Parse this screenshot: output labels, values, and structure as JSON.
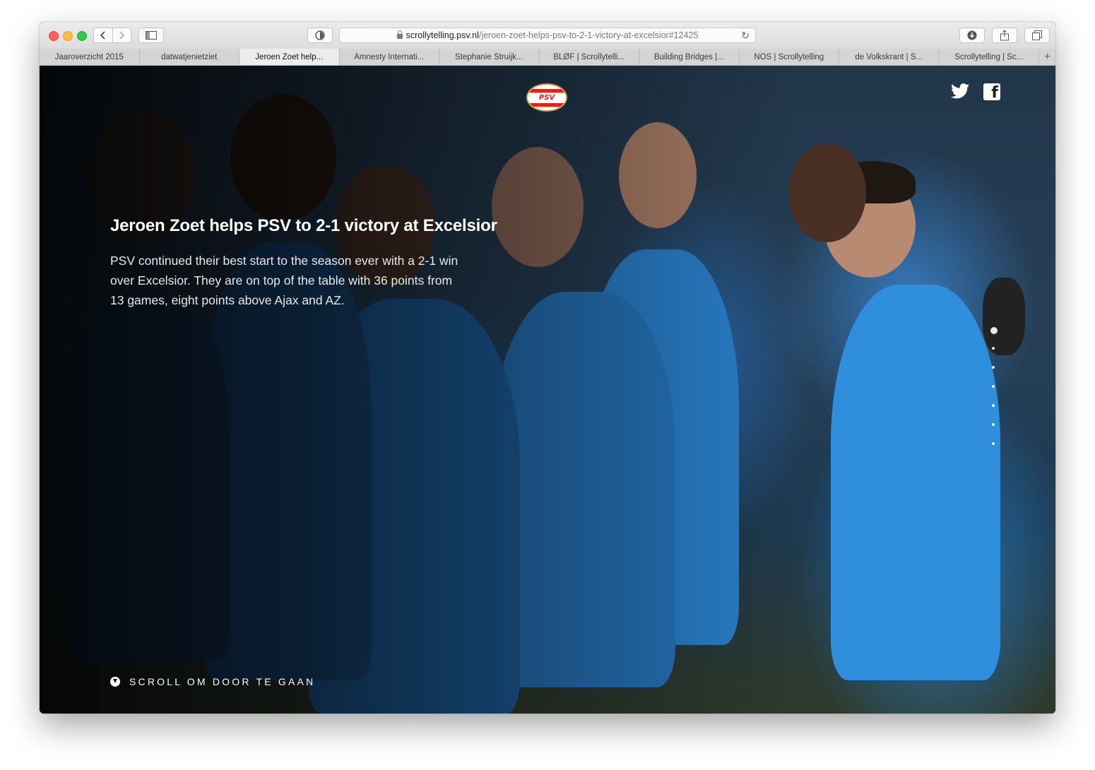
{
  "browser": {
    "url_domain": "scrollytelling.psv.nl",
    "url_path": "/jeroen-zoet-helps-psv-to-2-1-victory-at-excelsior#12425",
    "tabs": [
      {
        "label": "Jaaroverzicht 2015"
      },
      {
        "label": "datwatjenietziet"
      },
      {
        "label": "Jeroen Zoet help..."
      },
      {
        "label": "Amnesty Internati..."
      },
      {
        "label": "Stephanie Struijk..."
      },
      {
        "label": "BLØF | Scrollytelli..."
      },
      {
        "label": "Building Bridges |..."
      },
      {
        "label": "NOS | Scrollytelling"
      },
      {
        "label": "de Volkskrant | S..."
      },
      {
        "label": "Scrollytelling | Sc..."
      }
    ],
    "active_tab_index": 2,
    "add_tab_glyph": "+"
  },
  "page": {
    "logo_text": "PSV",
    "headline": "Jeroen Zoet helps PSV to 2-1 victory at Excelsior",
    "intro": "PSV continued their best start to the season ever with a 2-1 win over Excelsior. They are on top of the table with 36 points from 13 games, eight points above Ajax and AZ.",
    "scroll_hint": "SCROLL OM DOOR TE GAAN",
    "social": [
      "twitter-icon",
      "facebook-icon"
    ],
    "section_dots": 7,
    "active_section": 1
  },
  "colors": {
    "psv_red": "#e2231a",
    "jersey_blue": "#2f8fdc"
  }
}
